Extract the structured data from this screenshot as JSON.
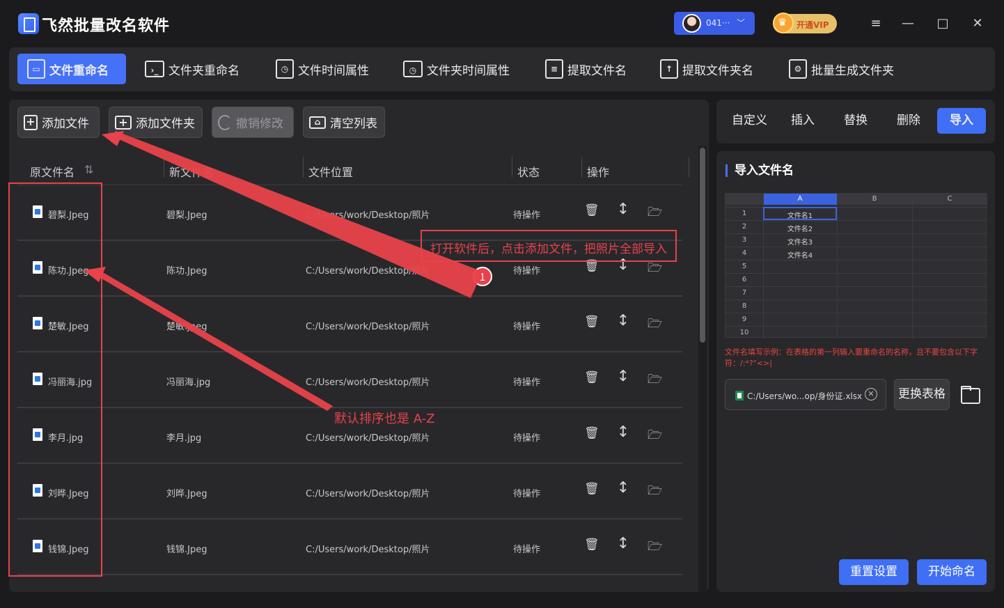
{
  "app": {
    "title": "飞然批量改名软件"
  },
  "user": {
    "name": "041···",
    "vip_label": "开通VIP"
  },
  "window_controls": [
    "≡",
    "—",
    "□",
    "✕"
  ],
  "tabs": [
    {
      "label": "文件重命名"
    },
    {
      "label": "文件夹重命名"
    },
    {
      "label": "文件时间属性"
    },
    {
      "label": "文件夹时间属性"
    },
    {
      "label": "提取文件名"
    },
    {
      "label": "提取文件夹名"
    },
    {
      "label": "批量生成文件夹"
    }
  ],
  "toolbar": {
    "add_file": "添加文件",
    "add_folder": "添加文件夹",
    "undo": "撤销修改",
    "clear_list": "清空列表"
  },
  "table": {
    "headers": {
      "original": "原文件名",
      "new": "新文件名",
      "location": "文件位置",
      "status": "状态",
      "actions": "操作"
    },
    "rows": [
      {
        "original": "碧梨.Jpeg",
        "new": "碧梨.Jpeg",
        "location": "C:/Users/work/Desktop/照片",
        "status": "待操作"
      },
      {
        "original": "陈功.Jpeg",
        "new": "陈功.Jpeg",
        "location": "C:/Users/work/Desktop/照片",
        "status": "待操作"
      },
      {
        "original": "楚敏.Jpeg",
        "new": "楚敏.Jpeg",
        "location": "C:/Users/work/Desktop/照片",
        "status": "待操作"
      },
      {
        "original": "冯丽海.jpg",
        "new": "冯丽海.jpg",
        "location": "C:/Users/work/Desktop/照片",
        "status": "待操作"
      },
      {
        "original": "李月.jpg",
        "new": "李月.jpg",
        "location": "C:/Users/work/Desktop/照片",
        "status": "待操作"
      },
      {
        "original": "刘晔.Jpeg",
        "new": "刘晔.Jpeg",
        "location": "C:/Users/work/Desktop/照片",
        "status": "待操作"
      },
      {
        "original": "钱锦.Jpeg",
        "new": "钱锦.Jpeg",
        "location": "C:/Users/work/Desktop/照片",
        "status": "待操作"
      }
    ]
  },
  "right_tabs": [
    {
      "label": "自定义"
    },
    {
      "label": "插入"
    },
    {
      "label": "替换"
    },
    {
      "label": "删除"
    },
    {
      "label": "导入"
    }
  ],
  "import_panel": {
    "title": "导入文件名",
    "sheet_columns": [
      "A",
      "B",
      "C"
    ],
    "sheet_rows": [
      {
        "n": "1",
        "a": "文件名1"
      },
      {
        "n": "2",
        "a": "文件名2"
      },
      {
        "n": "3",
        "a": "文件名3"
      },
      {
        "n": "4",
        "a": "文件名4"
      },
      {
        "n": "5",
        "a": ""
      },
      {
        "n": "6",
        "a": ""
      },
      {
        "n": "7",
        "a": ""
      },
      {
        "n": "8",
        "a": ""
      },
      {
        "n": "9",
        "a": ""
      },
      {
        "n": "10",
        "a": ""
      }
    ],
    "hint": "文件名填写示例：在表格的第一列输入要重命名的名称，且不要包含以下字符：/:*?\"<>|",
    "file_path": "C:/Users/wo...op/身份证.xlsx",
    "swap_label": "更换表格",
    "reset_label": "重置设置",
    "start_label": "开始命名"
  },
  "annotations": {
    "callout": "打开软件后，点击添加文件，把照片全部导入",
    "badge": "1",
    "sort_note": "默认排序也是 A-Z"
  },
  "colors": {
    "accent": "#4471f7",
    "annotation": "#e8424a",
    "background": "#1b1b1d",
    "panel": "#28282b"
  }
}
